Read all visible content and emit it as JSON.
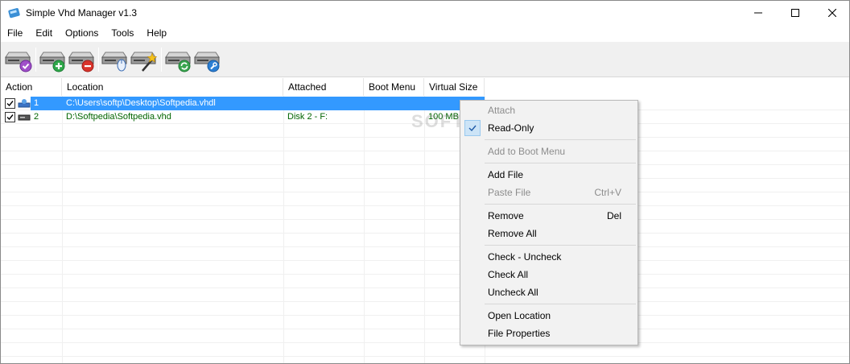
{
  "window": {
    "title": "Simple Vhd Manager v1.3"
  },
  "menu": [
    "File",
    "Edit",
    "Options",
    "Tools",
    "Help"
  ],
  "toolbar": {
    "buttons": [
      "attach-disk",
      "add-disk",
      "remove-disk",
      "boot-disk",
      "magic-disk",
      "refresh-disk",
      "settings-disk"
    ]
  },
  "list": {
    "columns": [
      "Action",
      "Location",
      "Attached",
      "Boot Menu",
      "Virtual Size"
    ],
    "rows": [
      {
        "num": "1",
        "location": "C:\\Users\\softp\\Desktop\\Softpedia.vhdl",
        "attached": "",
        "boot": "",
        "size": ""
      },
      {
        "num": "2",
        "location": "D:\\Softpedia\\Softpedia.vhd",
        "attached": "Disk 2  -  F:",
        "boot": "",
        "size": "100 MB"
      }
    ]
  },
  "context_menu": {
    "attach": "Attach",
    "read_only": "Read-Only",
    "add_boot": "Add to Boot Menu",
    "add_file": "Add File",
    "paste_file": "Paste File",
    "paste_shortcut": "Ctrl+V",
    "remove": "Remove",
    "remove_shortcut": "Del",
    "remove_all": "Remove All",
    "check_uncheck": "Check - Uncheck",
    "check_all": "Check All",
    "uncheck_all": "Uncheck All",
    "open_location": "Open Location",
    "file_properties": "File Properties"
  },
  "watermark": "SOFTPEDIA",
  "colors": {
    "selection": "#3399ff",
    "row_text_green": "#006400",
    "menu_disabled": "#8d8d8d"
  }
}
